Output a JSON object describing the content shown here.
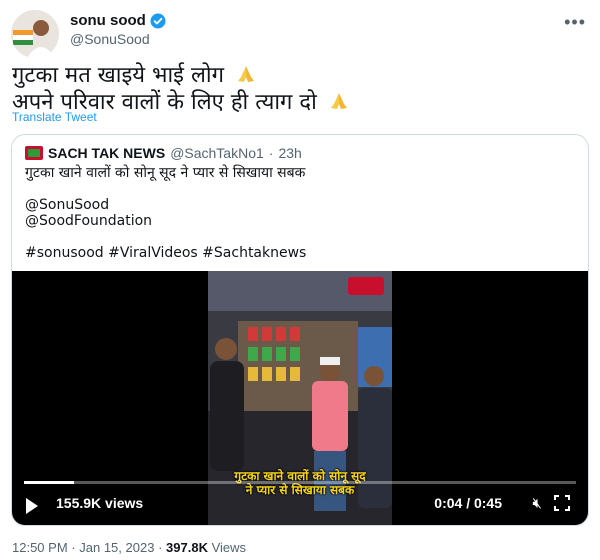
{
  "author": {
    "name": "sonu sood",
    "handle": "@SonuSood",
    "verified_icon": "verified-badge-icon",
    "avatar_icon": "profile-avatar"
  },
  "tweet": {
    "lines": [
      "गुटका मत खाइये भाई लोग",
      "अपने परिवार वालों के लिए ही त्याग दो"
    ],
    "emoji_icon": "folded-hands-emoji",
    "translate_label": "Translate Tweet"
  },
  "quoted": {
    "name": "SACH TAK NEWS",
    "handle": "@SachTakNo1",
    "separator": "·",
    "age": "23h",
    "text_line": "गुटका खाने वालों को सोनू सूद ने प्यार से सिखाया सबक",
    "mentions": [
      "@SonuSood",
      "@SoodFoundation"
    ],
    "hashtags": "#sonusood #ViralVideos #Sachtaknews",
    "video": {
      "views": "155.9K views",
      "time": "0:04 / 0:45",
      "progress": 0.09,
      "caption_lines": [
        "गुटका खाने वालों को सोनू सूद",
        "ने प्यार से सिखाया सबक"
      ]
    }
  },
  "footer": {
    "time": "12:50 PM",
    "dot1": "·",
    "date": "Jan 15, 2023",
    "dot2": "·",
    "views_count": "397.8K",
    "views_label": "Views"
  },
  "colors": {
    "link": "#1d9bf0",
    "secondary_text": "#536471",
    "border": "#cfd9de"
  }
}
